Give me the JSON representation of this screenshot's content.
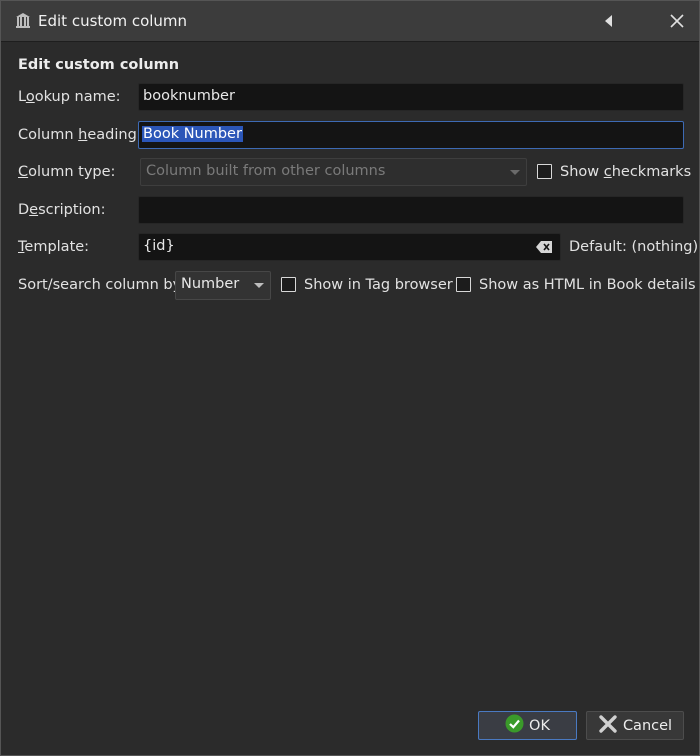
{
  "window": {
    "title": "Edit custom column"
  },
  "dialog": {
    "heading": "Edit custom column",
    "lookup": {
      "label_pre": "L",
      "label_u": "o",
      "label_post": "okup name:",
      "value": "booknumber"
    },
    "heading_field": {
      "label_pre": "Column ",
      "label_u": "h",
      "label_post": "eading:",
      "value": "Book Number"
    },
    "column_type": {
      "label_pre": "",
      "label_u": "C",
      "label_post": "olumn type:",
      "value": "Column built from other columns",
      "enabled": false
    },
    "show_checkmarks": {
      "label_pre": "Show ",
      "label_u": "c",
      "label_post": "heckmarks",
      "checked": false
    },
    "description": {
      "label_pre": "D",
      "label_u": "e",
      "label_post": "scription:",
      "value": ""
    },
    "template": {
      "label_pre": "",
      "label_u": "T",
      "label_post": "emplate:",
      "value": "{id}",
      "default_text": "Default: (nothing)"
    },
    "sort_by": {
      "label": "Sort/search column by",
      "value": "Number"
    },
    "show_in_tag_browser": {
      "label": "Show in Tag browser",
      "checked": false
    },
    "show_as_html": {
      "label": "Show as HTML in Book details",
      "checked": false
    }
  },
  "buttons": {
    "ok": "OK",
    "cancel": "Cancel"
  },
  "colors": {
    "background": "#2b2b2b",
    "field": "#141414",
    "selection": "#2b56b8",
    "ok_icon": "#3a9a2a",
    "cancel_icon": "#d0d0d0"
  },
  "icons": [
    "library-icon",
    "pin-icon",
    "close-icon",
    "clear-icon",
    "ok-check-icon",
    "cancel-x-icon"
  ]
}
